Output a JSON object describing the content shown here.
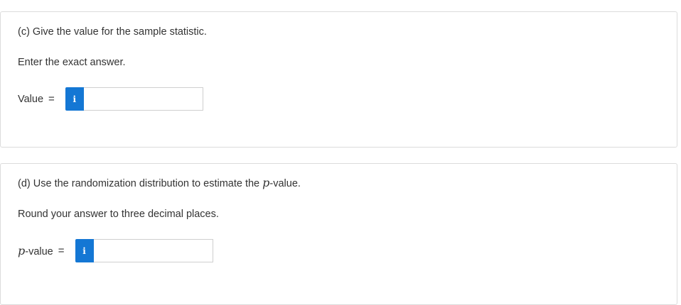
{
  "part_c": {
    "question": "(c) Give the value for the sample statistic.",
    "instruction": "Enter the exact answer.",
    "label": "Value",
    "equals": "=",
    "info_glyph": "i",
    "input_value": "",
    "icon": "info-icon"
  },
  "part_d": {
    "question_prefix": "(d) Use the randomization distribution to estimate the ",
    "question_p": "p",
    "question_suffix": "-value.",
    "instruction": "Round your answer to three decimal places.",
    "label_p": "p",
    "label_suffix": "-value",
    "equals": "=",
    "info_glyph": "i",
    "input_value": "",
    "icon": "info-icon"
  },
  "colors": {
    "info_button": "#1477d4",
    "border": "#dcdcdc",
    "text": "#333333"
  }
}
